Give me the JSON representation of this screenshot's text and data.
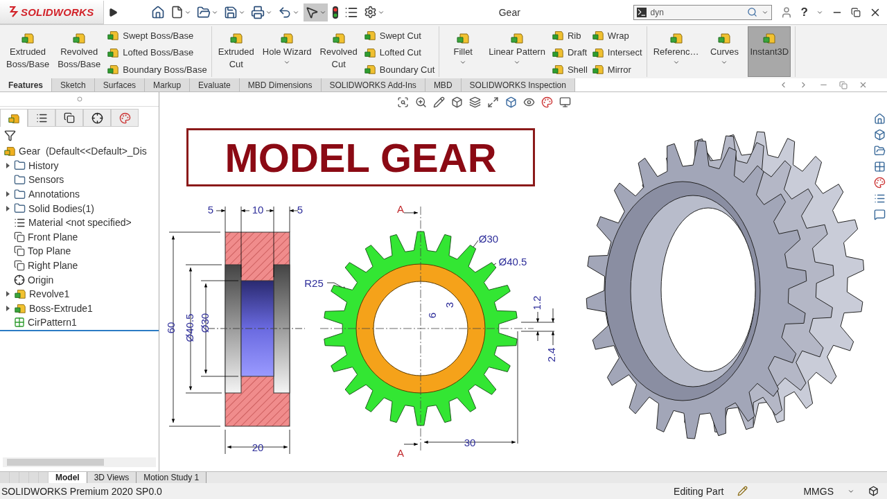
{
  "app": {
    "logo": "SOLIDWORKS",
    "title": "Gear",
    "search": {
      "value": "dyn"
    },
    "help": "?"
  },
  "ribbon": {
    "groups": [
      {
        "items": [
          {
            "kind": "large",
            "lines": [
              "Extruded",
              "Boss/Base"
            ],
            "caret": false
          },
          {
            "kind": "large",
            "lines": [
              "Revolved",
              "Boss/Base"
            ],
            "caret": false
          },
          {
            "kind": "stack",
            "entries": [
              "Swept Boss/Base",
              "Lofted Boss/Base",
              "Boundary Boss/Base"
            ]
          }
        ]
      },
      {
        "items": [
          {
            "kind": "large",
            "lines": [
              "Extruded",
              "Cut"
            ],
            "caret": false
          },
          {
            "kind": "large",
            "lines": [
              "Hole Wizard"
            ],
            "caret": true
          },
          {
            "kind": "large",
            "lines": [
              "Revolved",
              "Cut"
            ],
            "caret": false
          },
          {
            "kind": "stack",
            "entries": [
              "Swept Cut",
              "Lofted Cut",
              "Boundary Cut"
            ]
          }
        ]
      },
      {
        "items": [
          {
            "kind": "large",
            "lines": [
              "Fillet"
            ],
            "caret": true
          },
          {
            "kind": "large",
            "lines": [
              "Linear Pattern"
            ],
            "caret": true
          },
          {
            "kind": "stack",
            "entries": [
              "Rib",
              "Draft",
              "Shell"
            ]
          },
          {
            "kind": "stack",
            "entries": [
              "Wrap",
              "Intersect",
              "Mirror"
            ]
          }
        ]
      },
      {
        "items": [
          {
            "kind": "large",
            "lines": [
              "Referenc…"
            ],
            "caret": true
          },
          {
            "kind": "large",
            "lines": [
              "Curves"
            ],
            "caret": true
          },
          {
            "kind": "toggle",
            "lines": [
              "Instant3D"
            ],
            "selected": true
          }
        ]
      }
    ]
  },
  "command_tabs": [
    {
      "label": "Features",
      "selected": true
    },
    {
      "label": "Sketch",
      "selected": false
    },
    {
      "label": "Surfaces",
      "selected": false
    },
    {
      "label": "Markup",
      "selected": false
    },
    {
      "label": "Evaluate",
      "selected": false
    },
    {
      "label": "MBD Dimensions",
      "selected": false
    },
    {
      "label": "SOLIDWORKS Add-Ins",
      "selected": false
    },
    {
      "label": "MBD",
      "selected": false
    },
    {
      "label": "SOLIDWORKS Inspection",
      "selected": false
    }
  ],
  "panel_tabs": [
    {
      "selected": true
    },
    {
      "selected": false
    },
    {
      "selected": false
    },
    {
      "selected": false
    },
    {
      "selected": false
    }
  ],
  "feature_tree": {
    "label": "Gear  (Default<<Default>_Dis",
    "children": [
      {
        "label": "History",
        "kind": "folder",
        "expandable": true
      },
      {
        "label": "Sensors",
        "kind": "folder",
        "expandable": false
      },
      {
        "label": "Annotations",
        "kind": "folder",
        "expandable": true
      },
      {
        "label": "Solid Bodies(1)",
        "kind": "folder",
        "expandable": true
      },
      {
        "label": "Material <not specified>",
        "kind": "material",
        "expandable": false
      },
      {
        "label": "Front Plane",
        "kind": "plane",
        "expandable": false
      },
      {
        "label": "Top Plane",
        "kind": "plane",
        "expandable": false
      },
      {
        "label": "Right Plane",
        "kind": "plane",
        "expandable": false
      },
      {
        "label": "Origin",
        "kind": "origin",
        "expandable": false
      },
      {
        "label": "Revolve1",
        "kind": "feature",
        "expandable": true
      },
      {
        "label": "Boss-Extrude1",
        "kind": "feature",
        "expandable": true
      },
      {
        "label": "CirPattern1",
        "kind": "pattern",
        "expandable": false
      }
    ]
  },
  "viewport": {
    "banner": "MODEL GEAR",
    "section_dims": [
      "5",
      "10",
      "5",
      "60",
      "Ø40.5",
      "Ø30",
      "20"
    ],
    "front_dims": [
      "A",
      "Ø30",
      "Ø40.5",
      "R25",
      "6",
      "3",
      "1.2",
      "2.4",
      "30",
      "A"
    ]
  },
  "model_tabs": [
    {
      "label": "Model",
      "selected": true
    },
    {
      "label": "3D Views",
      "selected": false
    },
    {
      "label": "Motion Study 1",
      "selected": false
    }
  ],
  "status_bar": {
    "product": "SOLIDWORKS Premium 2020 SP0.0",
    "mode": "Editing Part",
    "units": "MMGS"
  }
}
